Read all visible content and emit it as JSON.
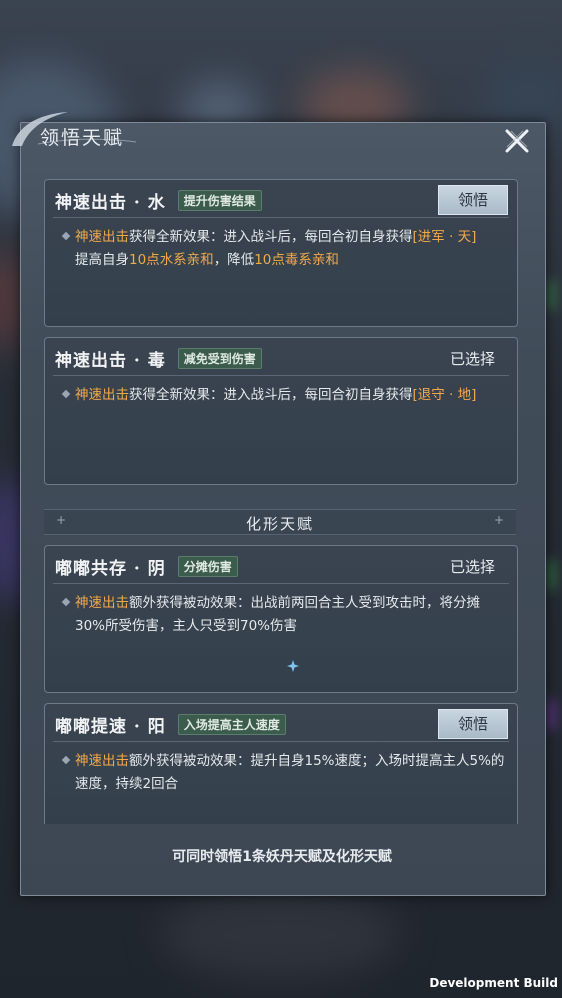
{
  "panel": {
    "title": "领悟天赋",
    "close_icon": "close-x-icon"
  },
  "cards": [
    {
      "name": "神速出击 · 水",
      "tag": "提升伤害结果",
      "action": "领悟",
      "desc": {
        "skill": "神速出击",
        "text1": "获得全新效果：进入战斗后，每回合初自身获得",
        "buff": "[进军 · 天]",
        "line2_prefix": "提高自身",
        "num1": "10点",
        "attr1": "水系亲和",
        "mid": "，降低",
        "num2": "10点",
        "attr2": "毒系亲和"
      }
    },
    {
      "name": "神速出击 · 毒",
      "tag": "减免受到伤害",
      "status": "已选择",
      "desc": {
        "skill": "神速出击",
        "text1": "获得全新效果：进入战斗后，每回合初自身获得",
        "buff": "[退守 · 地]"
      }
    },
    {
      "name": "嘟嘟共存 · 阴",
      "tag": "分摊伤害",
      "status": "已选择",
      "desc": {
        "skill": "神速出击",
        "text1": "额外获得被动效果：出战前两回合主人受到攻击时，将分摊30%所受伤害，主人只受到70%伤害"
      }
    },
    {
      "name": "嘟嘟提速 · 阳",
      "tag": "入场提高主人速度",
      "action": "领悟",
      "desc": {
        "skill": "神速出击",
        "text1": "额外获得被动效果：提升自身15%速度；入场时提高主人5%的速度，持续2回合"
      }
    }
  ],
  "section": {
    "title": "化形天赋",
    "plus_left": "+",
    "plus_right": "+"
  },
  "footer_note": "可同时领悟1条妖丹天赋及化形天赋",
  "dev_build": "Development Build",
  "colors": {
    "highlight": "#f2a94a",
    "tag_bg": "#3b5b4c",
    "panel": "#414c59"
  }
}
